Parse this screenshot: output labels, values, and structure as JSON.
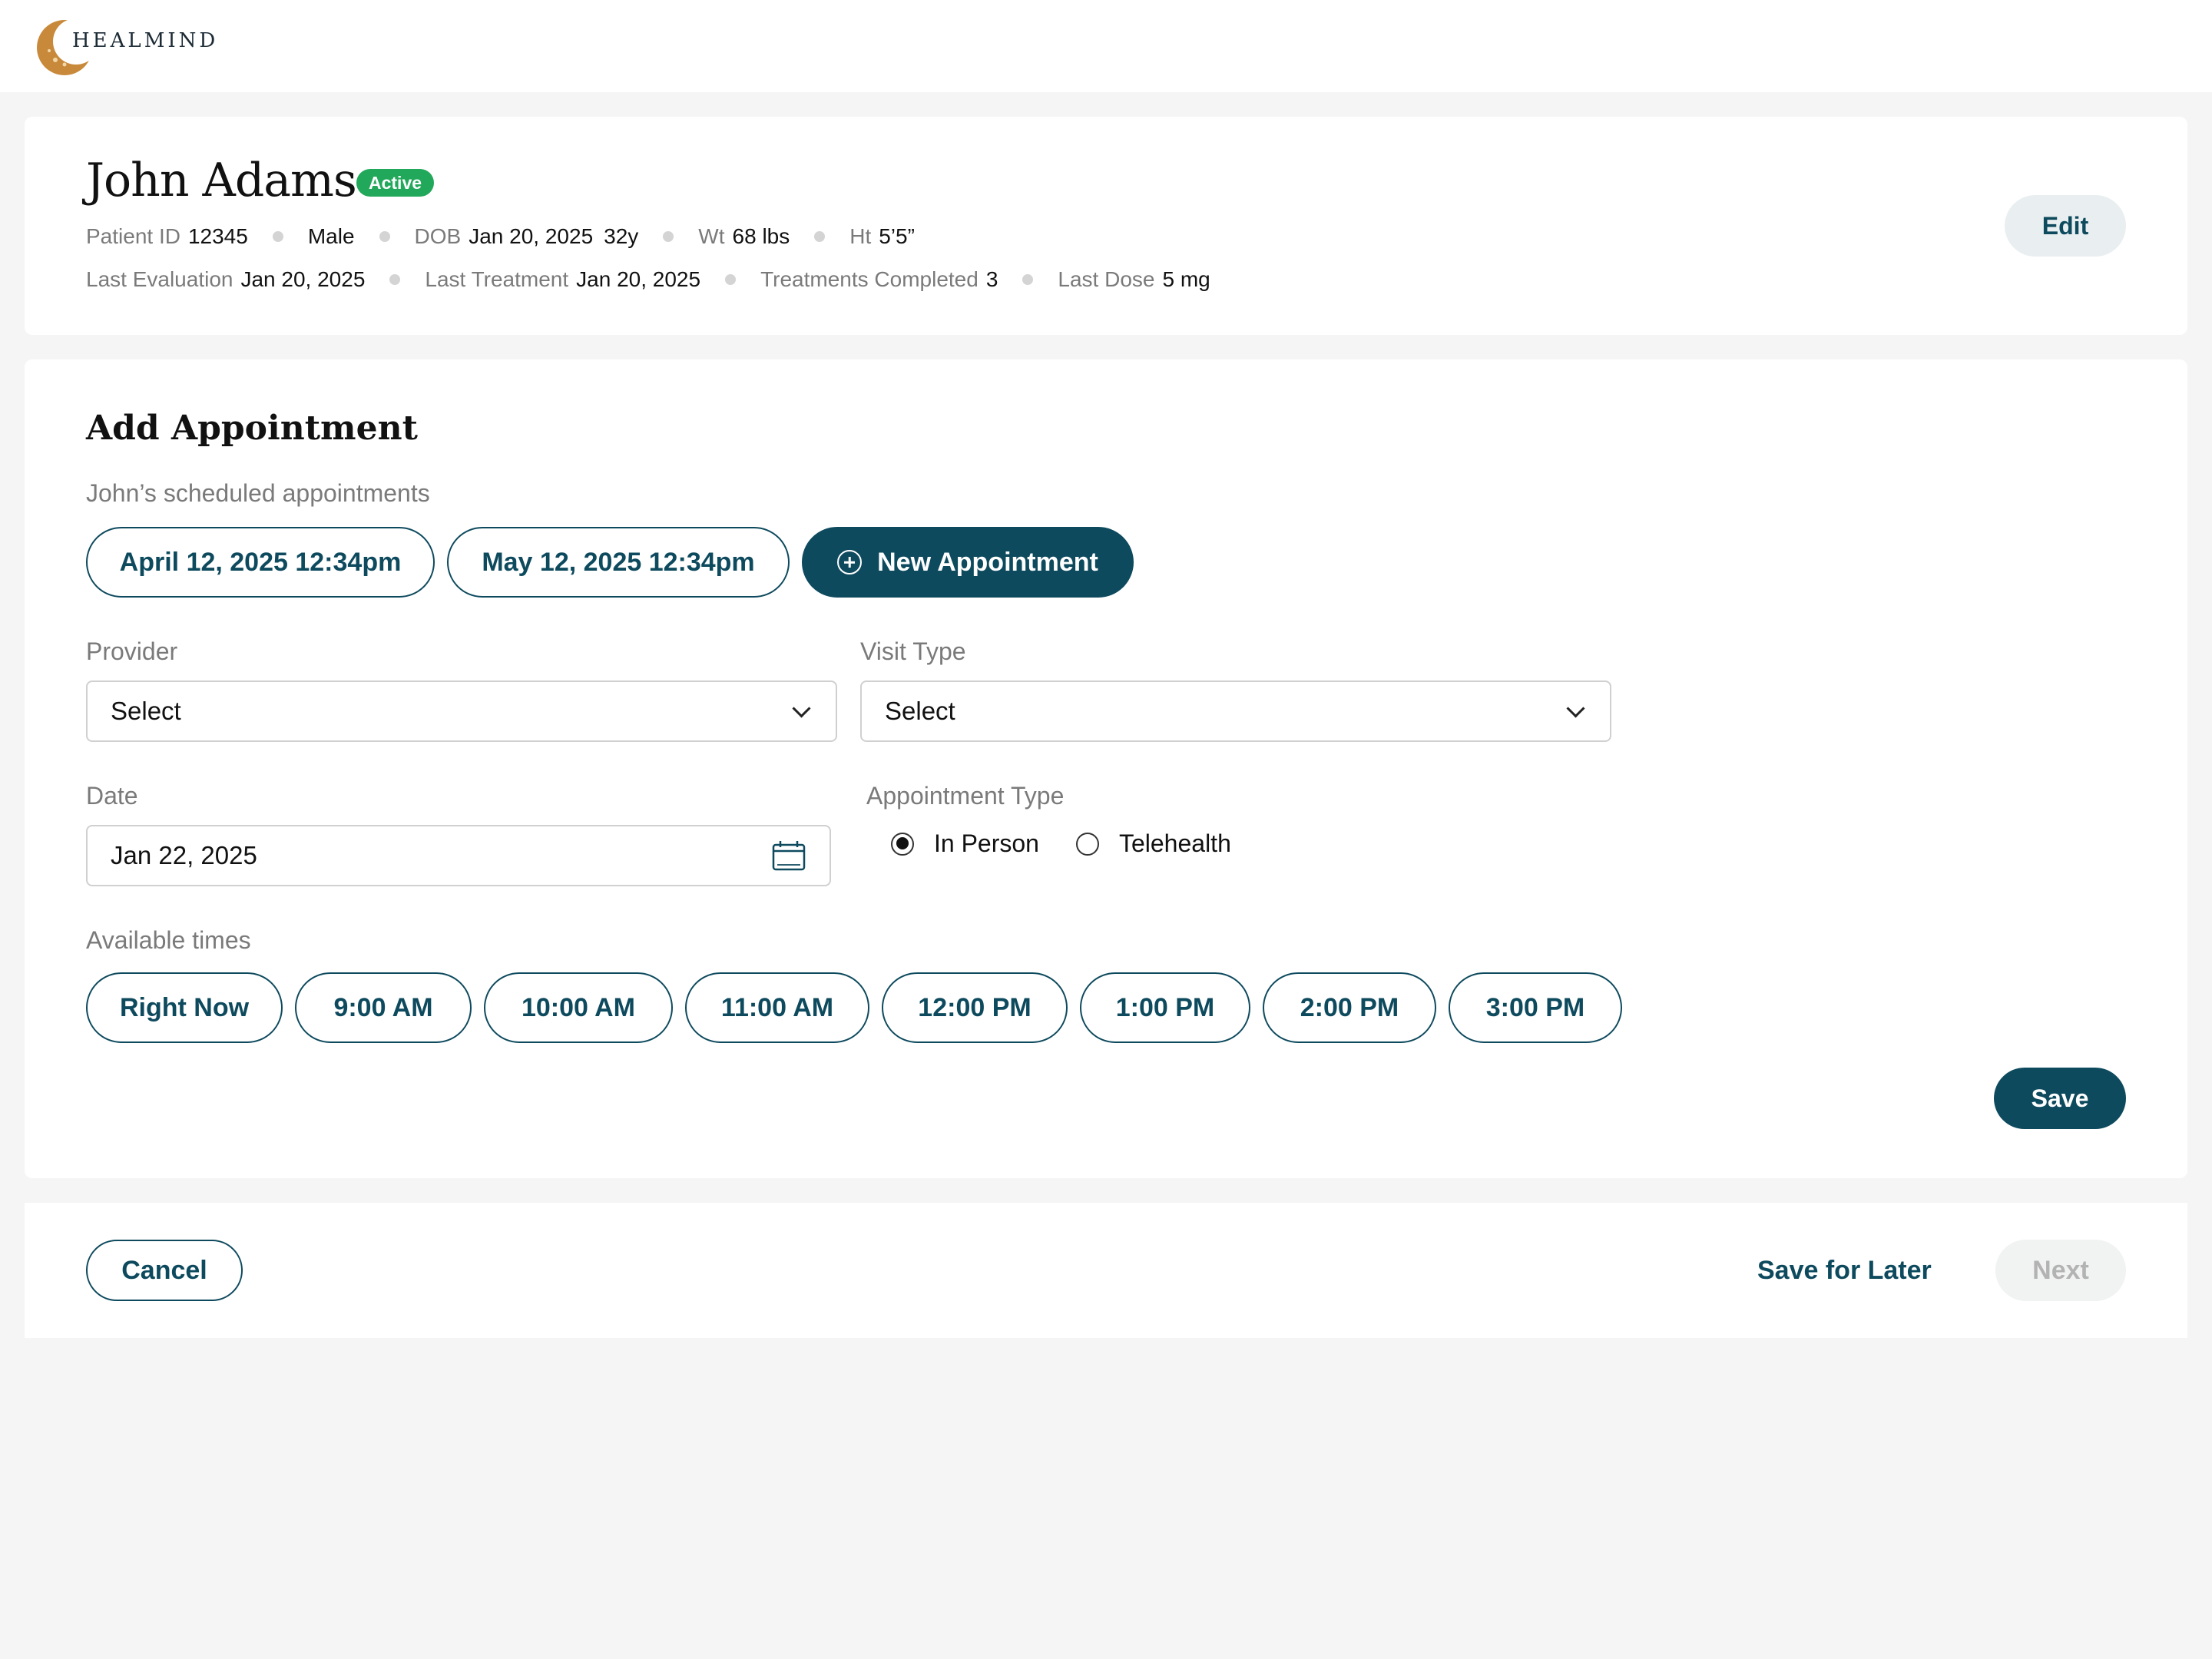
{
  "brand": {
    "name": "HEALMIND",
    "logo_icon": "crescent-moon-logo-icon",
    "logo_color": "#c8893a"
  },
  "patient": {
    "name": "John Adams",
    "status": "Active",
    "id_label": "Patient ID",
    "id_value": "12345",
    "gender": "Male",
    "dob_label": "DOB",
    "dob_value": "Jan 20, 2025",
    "age": "32y",
    "wt_label": "Wt",
    "wt_value": "68 lbs",
    "ht_label": "Ht",
    "ht_value": "5’5”",
    "last_eval_label": "Last Evaluation",
    "last_eval_value": "Jan 20, 2025",
    "last_treat_label": "Last Treatment",
    "last_treat_value": "Jan 20, 2025",
    "treat_completed_label": "Treatments Completed",
    "treat_completed_value": "3",
    "last_dose_label": "Last Dose",
    "last_dose_value": "5 mg",
    "edit_label": "Edit"
  },
  "appointment": {
    "title": "Add Appointment",
    "scheduled_label": "John’s scheduled appointments",
    "scheduled": [
      "April 12, 2025 12:34pm",
      "May 12, 2025 12:34pm"
    ],
    "new_label": "New Appointment",
    "provider": {
      "label": "Provider",
      "value": "Select"
    },
    "visit_type": {
      "label": "Visit Type",
      "value": "Select"
    },
    "date": {
      "label": "Date",
      "value": "Jan 22, 2025"
    },
    "appointment_type": {
      "label": "Appointment Type",
      "options": [
        "In Person",
        "Telehealth"
      ],
      "selected": "In Person"
    },
    "times_label": "Available times",
    "times": [
      "Right Now",
      "9:00 AM",
      "10:00 AM",
      "11:00 AM",
      "12:00 PM",
      "1:00 PM",
      "2:00 PM",
      "3:00 PM"
    ],
    "save_label": "Save"
  },
  "footer": {
    "cancel_label": "Cancel",
    "save_later_label": "Save for Later",
    "next_label": "Next"
  },
  "colors": {
    "primary": "#0e4a5e",
    "active_badge": "#22a85a",
    "background": "#f5f5f5"
  }
}
